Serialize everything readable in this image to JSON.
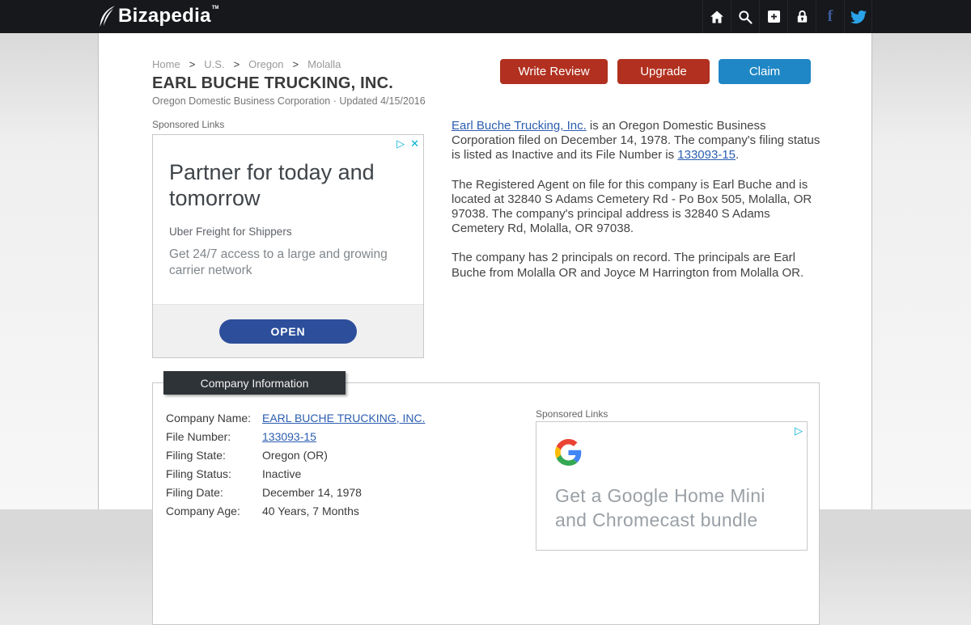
{
  "colors": {
    "header_bg": "#16181c",
    "accent_red": "#b1301f",
    "accent_blue": "#1f87c5",
    "link_blue": "#2b5db0",
    "adchoices_cyan": "#00b0d3",
    "open_button_blue": "#2c4e9b",
    "tab_bg": "#2e3338",
    "facebook_blue": "#3d5a96",
    "twitter_blue": "#2aa3e8",
    "google_blue": "#4285F4",
    "google_red": "#EA4335",
    "google_yellow": "#FBBC05",
    "google_green": "#34A853"
  },
  "header": {
    "logo_text": "Bizapedia",
    "logo_tm": "TM",
    "icons": [
      "home-icon",
      "search-icon",
      "add-icon",
      "lock-icon",
      "facebook-icon",
      "twitter-icon"
    ]
  },
  "breadcrumb": {
    "separator": ">",
    "items": [
      "Home",
      "U.S.",
      "Oregon",
      "Molalla"
    ]
  },
  "page": {
    "title": "EARL BUCHE TRUCKING, INC.",
    "subtitle": "Oregon Domestic Business Corporation · Updated 4/15/2016"
  },
  "actions": {
    "write_review": "Write Review",
    "upgrade": "Upgrade",
    "claim": "Claim"
  },
  "sponsored_left": {
    "label": "Sponsored Links",
    "adchoices": "▷",
    "close": "✕",
    "headline": "Partner for today and tomorrow",
    "advertiser": "Uber Freight for Shippers",
    "description": "Get 24/7 access to a large and growing carrier network",
    "open_label": "OPEN"
  },
  "about": {
    "p1": {
      "link1": "Earl Buche Trucking, Inc.",
      "part1": " is an Oregon Domestic Business Corporation filed on December 14, 1978. The company's filing status is listed as Inactive and its File Number is ",
      "link2": "133093-15",
      "part2": "."
    },
    "p2": "The Registered Agent on file for this company is Earl Buche and is located at 32840 S Adams Cemetery Rd - Po Box 505, Molalla, OR 97038. The company's principal address is 32840 S Adams Cemetery Rd, Molalla, OR 97038.",
    "p3": "The company has 2 principals on record. The principals are Earl Buche from Molalla OR and Joyce M Harrington from Molalla OR."
  },
  "company_info": {
    "tab_title": "Company Information",
    "rows": [
      {
        "label": "Company Name:",
        "value": "EARL BUCHE TRUCKING, INC."
      },
      {
        "label": "File Number:",
        "value": "133093-15"
      },
      {
        "label": "Filing State:",
        "value": "Oregon (OR)"
      },
      {
        "label": "Filing Status:",
        "value": "Inactive"
      },
      {
        "label": "Filing Date:",
        "value": "December 14, 1978"
      },
      {
        "label": "Company Age:",
        "value": "40 Years, 7 Months"
      }
    ],
    "sponsored": {
      "label": "Sponsored Links",
      "adchoices": "▷",
      "headline_line1": "Get a Google Home Mini",
      "headline_line2": "and Chromecast bundle"
    }
  }
}
